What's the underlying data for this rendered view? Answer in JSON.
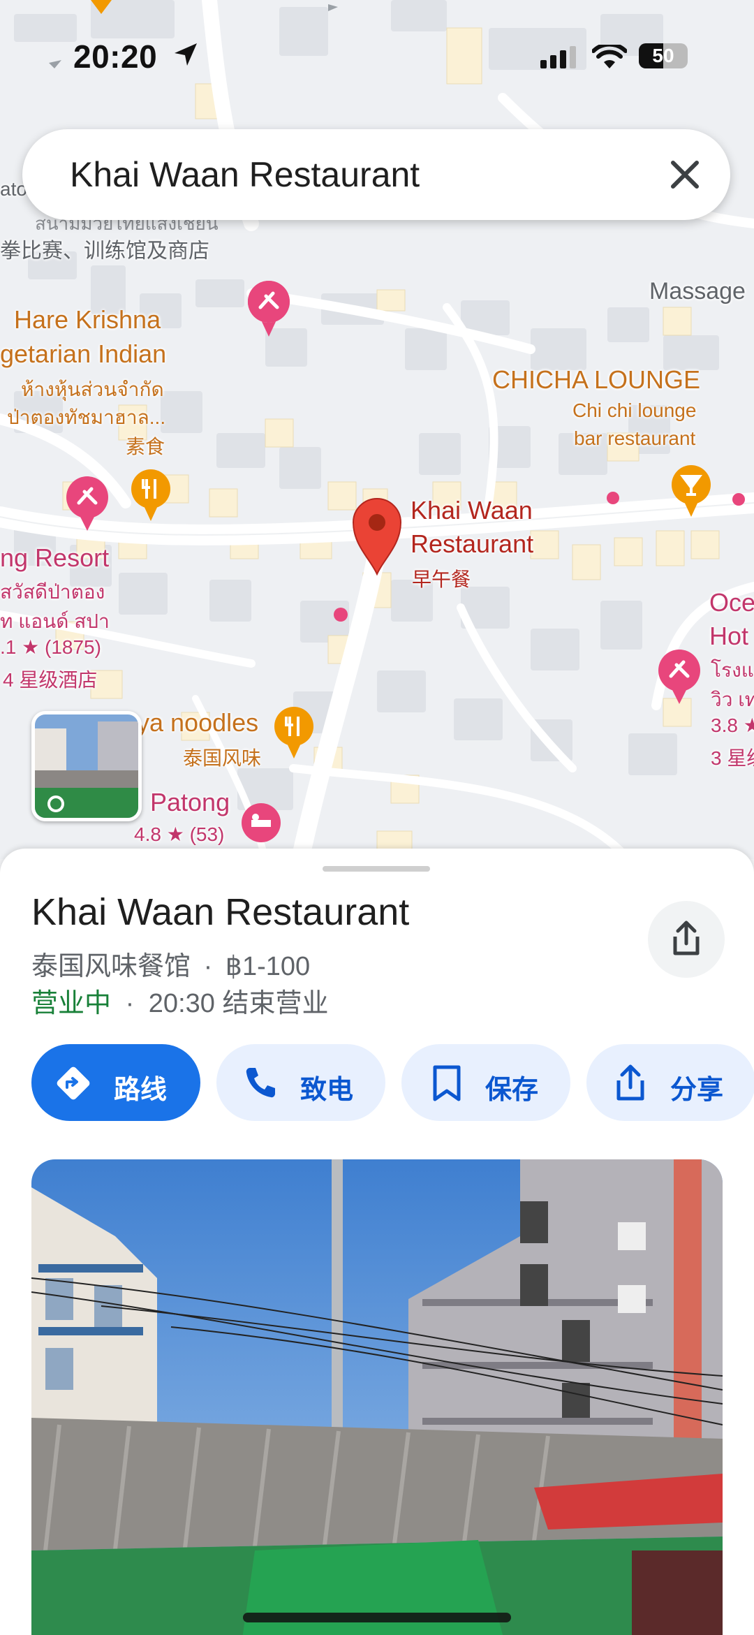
{
  "status_bar": {
    "time": "20:20",
    "battery": "50"
  },
  "search": {
    "query": "Khai Waan Restaurant"
  },
  "map_labels": {
    "sports_venue": "拳比赛、训练馆及商店",
    "thai_line_top": "สนามมวยไทยแสงเชี่ยน",
    "hare_krishna_1": "Hare Krishna",
    "hare_krishna_2": "getarian Indian",
    "hare_krishna_thai_1": "ห้างหุ้นส่วนจำกัด",
    "hare_krishna_thai_2": "ป่าตองทัชมาฮาล...",
    "hare_krishna_cat": "素食",
    "massage": "Massage",
    "chicha_1": "CHICHA LOUNGE",
    "chicha_2": "Chi chi lounge",
    "chicha_3": "bar restaurant",
    "selected_1": "Khai Waan",
    "selected_2": "Restaurant",
    "selected_cat": "早午餐",
    "resort_1": "ng Resort",
    "resort_2": "สวัสดีป่าตอง",
    "resort_3": "ท แอนด์ สปา",
    "resort_rating": ".1 ★ (1875)",
    "resort_cat": "4 星级酒店",
    "noodles_1": "ya noodles",
    "noodles_cat": "泰国风味",
    "patong_1": "Patong",
    "patong_rating": "4.8 ★ (53)",
    "ocean_1": "Oce",
    "ocean_2": "Hot",
    "ocean_3": "โรงแ",
    "ocean_4": "วิว เท",
    "ocean_rating": "3.8 ★",
    "ocean_cat": "3 星级",
    "left_edge": "ato"
  },
  "place": {
    "title": "Khai Waan Restaurant",
    "category": "泰国风味餐馆",
    "price": "฿1-100",
    "open_status": "营业中",
    "closing": "20:30 结束营业",
    "separator": "·"
  },
  "actions": [
    {
      "label": "路线"
    },
    {
      "label": "致电"
    },
    {
      "label": "保存"
    },
    {
      "label": "分享"
    }
  ],
  "colors": {
    "primary": "#1a73e8",
    "chip_bg": "#e8f0fe",
    "open_green": "#188038",
    "pin_red": "#ea4335",
    "poi_pink": "#e8467c",
    "poi_orange": "#f29900"
  }
}
